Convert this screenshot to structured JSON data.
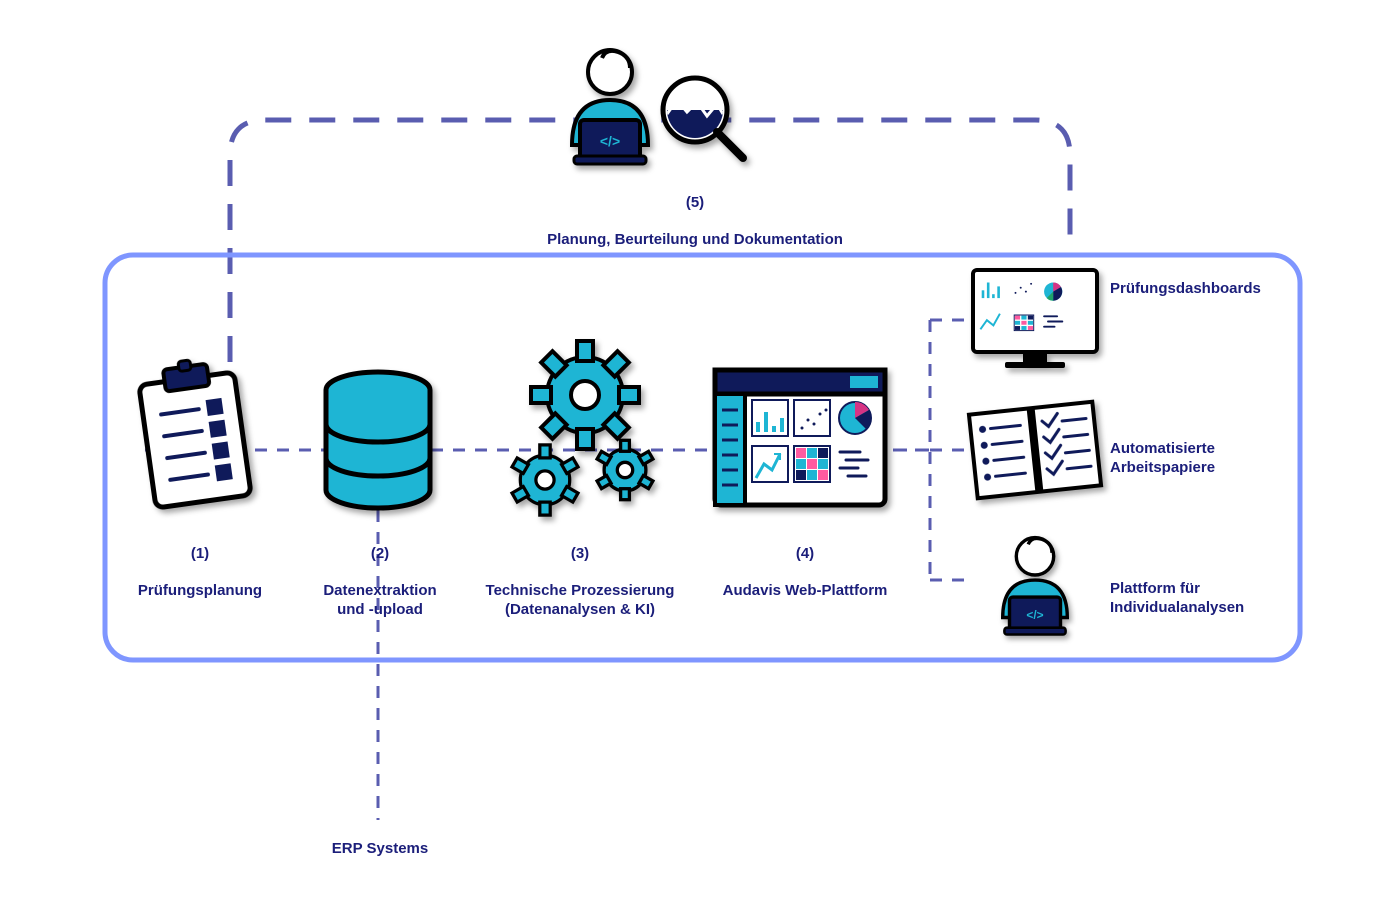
{
  "steps": {
    "1": {
      "num": "(1)",
      "title": "Prüfungsplanung"
    },
    "2": {
      "num": "(2)",
      "title": "Datenextraktion\nund -upload"
    },
    "3": {
      "num": "(3)",
      "title": "Technische Prozessierung\n(Datenanalysen & KI)"
    },
    "4": {
      "num": "(4)",
      "title": "Audavis Web-Plattform"
    },
    "5": {
      "num": "(5)",
      "title": "Planung, Beurteilung und Dokumentation"
    }
  },
  "outputs": {
    "dashboards": "Prüfungsdashboards",
    "papers": "Automatisierte\nArbeitspapiere",
    "individual": "Plattform für\nIndividualanalysen"
  },
  "erp": "ERP Systems",
  "colors": {
    "navy": "#0f1a5a",
    "cyan": "#1eb5d4",
    "border": "#7f96ff",
    "dash": "#5a5db0",
    "magenta": "#d63384",
    "green": "#1fa36a",
    "pink": "#ff5aa0"
  }
}
